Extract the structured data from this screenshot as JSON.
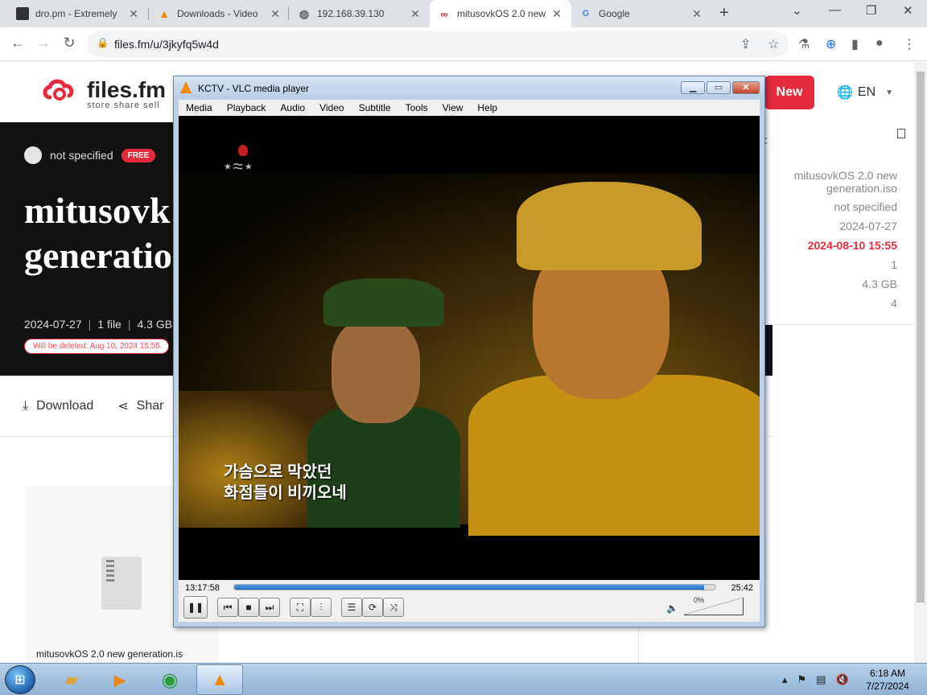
{
  "browser": {
    "tabs": [
      {
        "title": "dro.pm - Extremely",
        "favicon": "dro-icon",
        "fav_color": "#333333",
        "active": false
      },
      {
        "title": "Downloads - Video",
        "favicon": "vlc-cone-icon",
        "fav_color": "#f08a00",
        "active": false
      },
      {
        "title": "192.168.39.130",
        "favicon": "globe-icon",
        "fav_color": "#5f6368",
        "active": false
      },
      {
        "title": "mitusovkOS 2.0 new",
        "favicon": "filesfm-icon",
        "fav_color": "#e42b3c",
        "active": true
      },
      {
        "title": "Google",
        "favicon": "google-icon",
        "fav_color": "#4285f4",
        "active": false
      }
    ],
    "url": "files.fm/u/3jkyfq5w4d"
  },
  "site": {
    "brand": "files.fm",
    "tagline": "store share sell",
    "new_button": "New",
    "language": "EN",
    "owner": "not specified",
    "owner_badge": "FREE",
    "title_line1": "mitusovk",
    "title_line2": "generatio",
    "meta": {
      "date": "2024-07-27",
      "files": "1 file",
      "size": "4.3 GB"
    },
    "delete_notice": "Will be deleted: Aug 10, 2024 15:55",
    "actions": {
      "download": "Download",
      "share": "Shar"
    },
    "file_name": "mitusovkOS 2.0 new generation.is",
    "sidebar": {
      "colon": ":",
      "name": "mitusovkOS 2.0 new generation.iso",
      "owner": "not specified",
      "uploaded": "2024-07-27",
      "expires": "2024-08-10 15:55",
      "files": "1",
      "size": "4.3 GB",
      "downloads": "4"
    },
    "accent_color": "#e42b3c"
  },
  "vlc": {
    "title": "KCTV - VLC media player",
    "menu": [
      "Media",
      "Playback",
      "Audio",
      "Video",
      "Subtitle",
      "Tools",
      "View",
      "Help"
    ],
    "subtitle_line1": "가슴으로 막았던",
    "subtitle_line2": "화점들이 비끼오네",
    "elapsed": "13:17:58",
    "remaining": "25:42",
    "progress": 0.977,
    "volume": "0%"
  },
  "taskbar": {
    "time": "6:18 AM",
    "date": "7/27/2024"
  }
}
